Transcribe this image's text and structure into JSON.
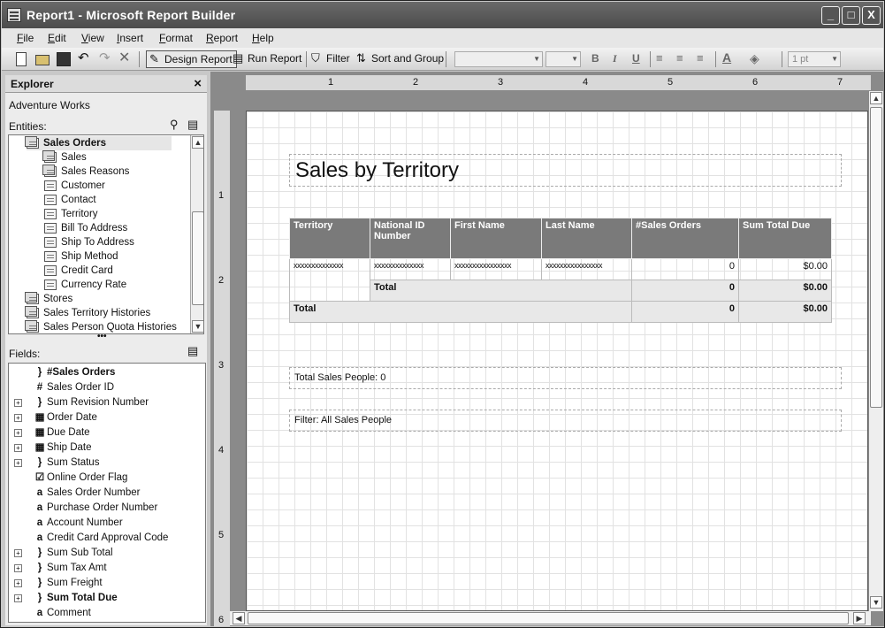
{
  "window": {
    "title": "Report1 - Microsoft Report Builder",
    "buttons": [
      "_",
      "□",
      "X"
    ]
  },
  "menu": [
    {
      "u": "F",
      "rest": "ile"
    },
    {
      "u": "E",
      "rest": "dit"
    },
    {
      "u": "V",
      "rest": "iew"
    },
    {
      "u": "I",
      "rest": "nsert"
    },
    {
      "u": "F",
      "rest": "ormat"
    },
    {
      "u": "R",
      "rest": "eport"
    },
    {
      "u": "H",
      "rest": "elp"
    }
  ],
  "toolbar": {
    "design_report": "Design Report",
    "run_report": "Run Report",
    "filter": "Filter",
    "sort_group": "Sort and Group",
    "font_size_value": "1 pt",
    "bold": "B",
    "italic": "I",
    "underline": "U",
    "text_color_glyph": "A"
  },
  "explorer": {
    "title": "Explorer",
    "close": "×",
    "model": "Adventure Works",
    "entities_label": "Entities:",
    "entities": [
      {
        "label": "Sales Orders",
        "level": 0,
        "bold": true,
        "selected": true,
        "stack": true
      },
      {
        "label": "Sales",
        "level": 1,
        "stack": true
      },
      {
        "label": "Sales Reasons",
        "level": 1,
        "stack": true
      },
      {
        "label": "Customer",
        "level": 1
      },
      {
        "label": "Contact",
        "level": 1
      },
      {
        "label": "Territory",
        "level": 1
      },
      {
        "label": "Bill To Address",
        "level": 1
      },
      {
        "label": "Ship To Address",
        "level": 1
      },
      {
        "label": "Ship Method",
        "level": 1
      },
      {
        "label": "Credit Card",
        "level": 1
      },
      {
        "label": "Currency Rate",
        "level": 1
      },
      {
        "label": "Stores",
        "level": 0,
        "stack": true
      },
      {
        "label": "Sales Territory Histories",
        "level": 0,
        "stack": true
      },
      {
        "label": "Sales Person Quota Histories",
        "level": 0,
        "stack": true
      }
    ],
    "fields_label": "Fields:",
    "fields": [
      {
        "label": "#Sales Orders",
        "icon": "}",
        "bold": true,
        "expand": false
      },
      {
        "label": "Sales Order ID",
        "icon": "#",
        "expand": false
      },
      {
        "label": "Sum Revision Number",
        "icon": "}",
        "expand": true
      },
      {
        "label": "Order Date",
        "icon": "▦",
        "expand": true
      },
      {
        "label": "Due Date",
        "icon": "▦",
        "expand": true
      },
      {
        "label": "Ship Date",
        "icon": "▦",
        "expand": true
      },
      {
        "label": "Sum Status",
        "icon": "}",
        "expand": true
      },
      {
        "label": "Online Order Flag",
        "icon": "☑",
        "expand": false
      },
      {
        "label": "Sales Order Number",
        "icon": "a",
        "expand": false
      },
      {
        "label": "Purchase Order Number",
        "icon": "a",
        "expand": false
      },
      {
        "label": "Account Number",
        "icon": "a",
        "expand": false
      },
      {
        "label": "Credit Card Approval Code",
        "icon": "a",
        "expand": false
      },
      {
        "label": "Sum Sub Total",
        "icon": "}",
        "expand": true
      },
      {
        "label": "Sum Tax Amt",
        "icon": "}",
        "expand": true
      },
      {
        "label": "Sum Freight",
        "icon": "}",
        "expand": true
      },
      {
        "label": "Sum Total Due",
        "icon": "}",
        "bold": true,
        "expand": true
      },
      {
        "label": "Comment",
        "icon": "a",
        "expand": false
      }
    ]
  },
  "ruler": {
    "h": [
      "1",
      "2",
      "3",
      "4",
      "5",
      "6",
      "7"
    ],
    "v": [
      "1",
      "2",
      "3",
      "4",
      "5",
      "6"
    ]
  },
  "report": {
    "title": "Sales by Territory",
    "headers": [
      "Territory",
      "National ID Number",
      "First Name",
      "Last Name",
      "#Sales Orders",
      "Sum Total Due"
    ],
    "detail": {
      "territory": "xxxxxxxxxxxxxx",
      "nid": "xxxxxxxxxxxxxx",
      "first": "xxxxxxxxxxxxxxxx",
      "last": "xxxxxxxxxxxxxxxx",
      "orders": "0",
      "due": "$0.00"
    },
    "subtotal": {
      "label": "Total",
      "orders": "0",
      "due": "$0.00"
    },
    "total": {
      "label": "Total",
      "orders": "0",
      "due": "$0.00"
    },
    "people": "Total Sales People: 0",
    "filter": "Filter: All Sales People"
  }
}
